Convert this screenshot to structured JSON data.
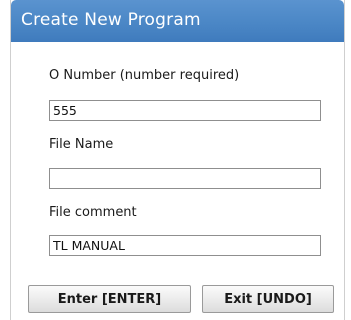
{
  "dialog": {
    "title": "Create New Program",
    "fields": {
      "onumber": {
        "label": "O Number (number required)",
        "value": "555"
      },
      "filename": {
        "label": "File Name",
        "value": ""
      },
      "comment": {
        "label": "File comment",
        "value": "TL MANUAL"
      }
    },
    "buttons": {
      "enter": "Enter [ENTER]",
      "exit": "Exit [UNDO]"
    }
  },
  "colors": {
    "title_bar": "#4b87c6",
    "title_text": "#ffffff"
  }
}
